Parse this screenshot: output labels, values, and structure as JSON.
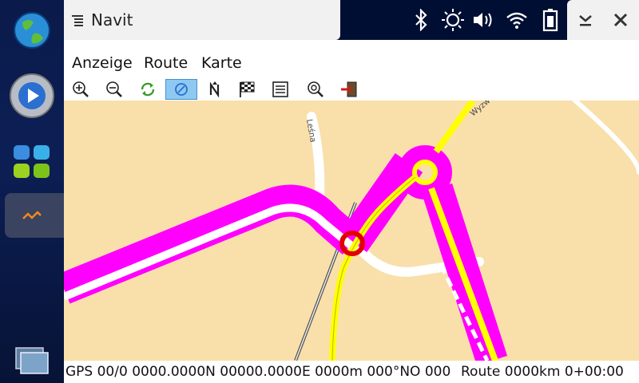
{
  "app": {
    "title": "Navit"
  },
  "menu": {
    "items": [
      "Anzeige",
      "Route",
      "Karte"
    ]
  },
  "toolbar": {
    "buttons": [
      {
        "icon": "zoom-in-icon"
      },
      {
        "icon": "zoom-out-icon"
      },
      {
        "icon": "refresh-icon"
      },
      {
        "icon": "follow-position-icon",
        "active": true
      },
      {
        "icon": "north-orientation-icon"
      },
      {
        "icon": "destination-flag-icon"
      },
      {
        "icon": "list-icon"
      },
      {
        "icon": "zoom-to-route-icon"
      },
      {
        "icon": "quit-icon"
      }
    ]
  },
  "map": {
    "street_labels": [
      "Leśna",
      "Wyzw"
    ],
    "colors": {
      "land": "#f9dfaa",
      "route": "#ff00ff",
      "main_road": "#ffff00",
      "road": "#ffffff",
      "position_marker": "#e00000"
    }
  },
  "status": {
    "gps": "GPS 00/0 0000.0000N 00000.0000E 0000m 000°NO 000",
    "route": "Route 0000km 0+00:00"
  },
  "launcher": {
    "items": [
      "web-browser-icon",
      "media-player-icon",
      "applications-icon",
      "navit-app-icon",
      "task-switcher-icon"
    ]
  }
}
